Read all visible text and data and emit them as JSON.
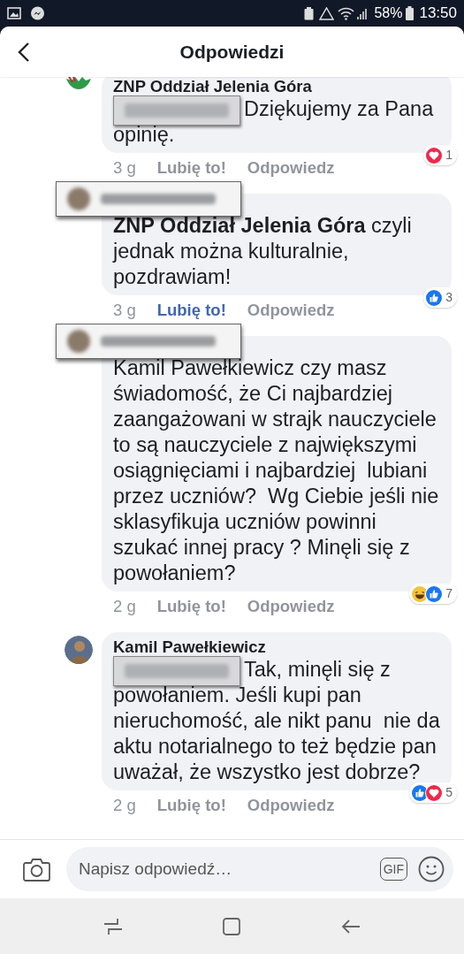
{
  "status_bar": {
    "battery": "58%",
    "time": "13:50"
  },
  "header": {
    "title": "Odpowiedzi"
  },
  "comments": [
    {
      "avatar": {
        "kind": "logo"
      },
      "author": "ZNP Oddział Jelenia Góra",
      "author_redacted": false,
      "mention_redacted": true,
      "text": "Dziękujemy za Pana opinię.",
      "time": "3 g",
      "like": "Lubię to!",
      "liked": false,
      "reply": "Odpowiedz",
      "reactions": [
        {
          "kind": "love"
        }
      ],
      "reaction_count": "1"
    },
    {
      "author_redacted": true,
      "mention_redacted": false,
      "text": "**ZNP Oddział Jelenia Góra** czyli jednak można kulturalnie, pozdrawiam!",
      "time": "3 g",
      "like": "Lubię to!",
      "liked": true,
      "reply": "Odpowiedz",
      "reactions": [
        {
          "kind": "like"
        }
      ],
      "reaction_count": "3"
    },
    {
      "author_redacted": true,
      "mention_redacted": false,
      "text": "Kamil Pawełkiewicz czy masz świadomość, że Ci najbardziej zaangażowani w strajk nauczyciele to są nauczyciele z największymi osiągnięciami i najbardziej  lubiani przez uczniów?  Wg Ciebie jeśli nie sklasyfikuja uczniów powinni szukać innej pracy ? Minęli się z powołaniem?",
      "time": "2 g",
      "like": "Lubię to!",
      "liked": false,
      "reply": "Odpowiedz",
      "reactions": [
        {
          "kind": "haha"
        },
        {
          "kind": "like"
        }
      ],
      "reaction_count": "7"
    },
    {
      "avatar": {
        "kind": "photo"
      },
      "author": "Kamil Pawełkiewicz",
      "author_redacted": false,
      "mention_redacted": true,
      "text": "Tak, minęli się z powołaniem. Jeśli kupi pan nieruchomość, ale nikt panu  nie da aktu notarialnego to też będzie pan uważał, że wszystko jest dobrze?",
      "time": "2 g",
      "like": "Lubię to!",
      "liked": false,
      "reply": "Odpowiedz",
      "reactions": [
        {
          "kind": "like"
        },
        {
          "kind": "love"
        }
      ],
      "reaction_count": "5"
    }
  ],
  "composer": {
    "placeholder": "Napisz odpowiedź…",
    "gif": "GIF"
  }
}
